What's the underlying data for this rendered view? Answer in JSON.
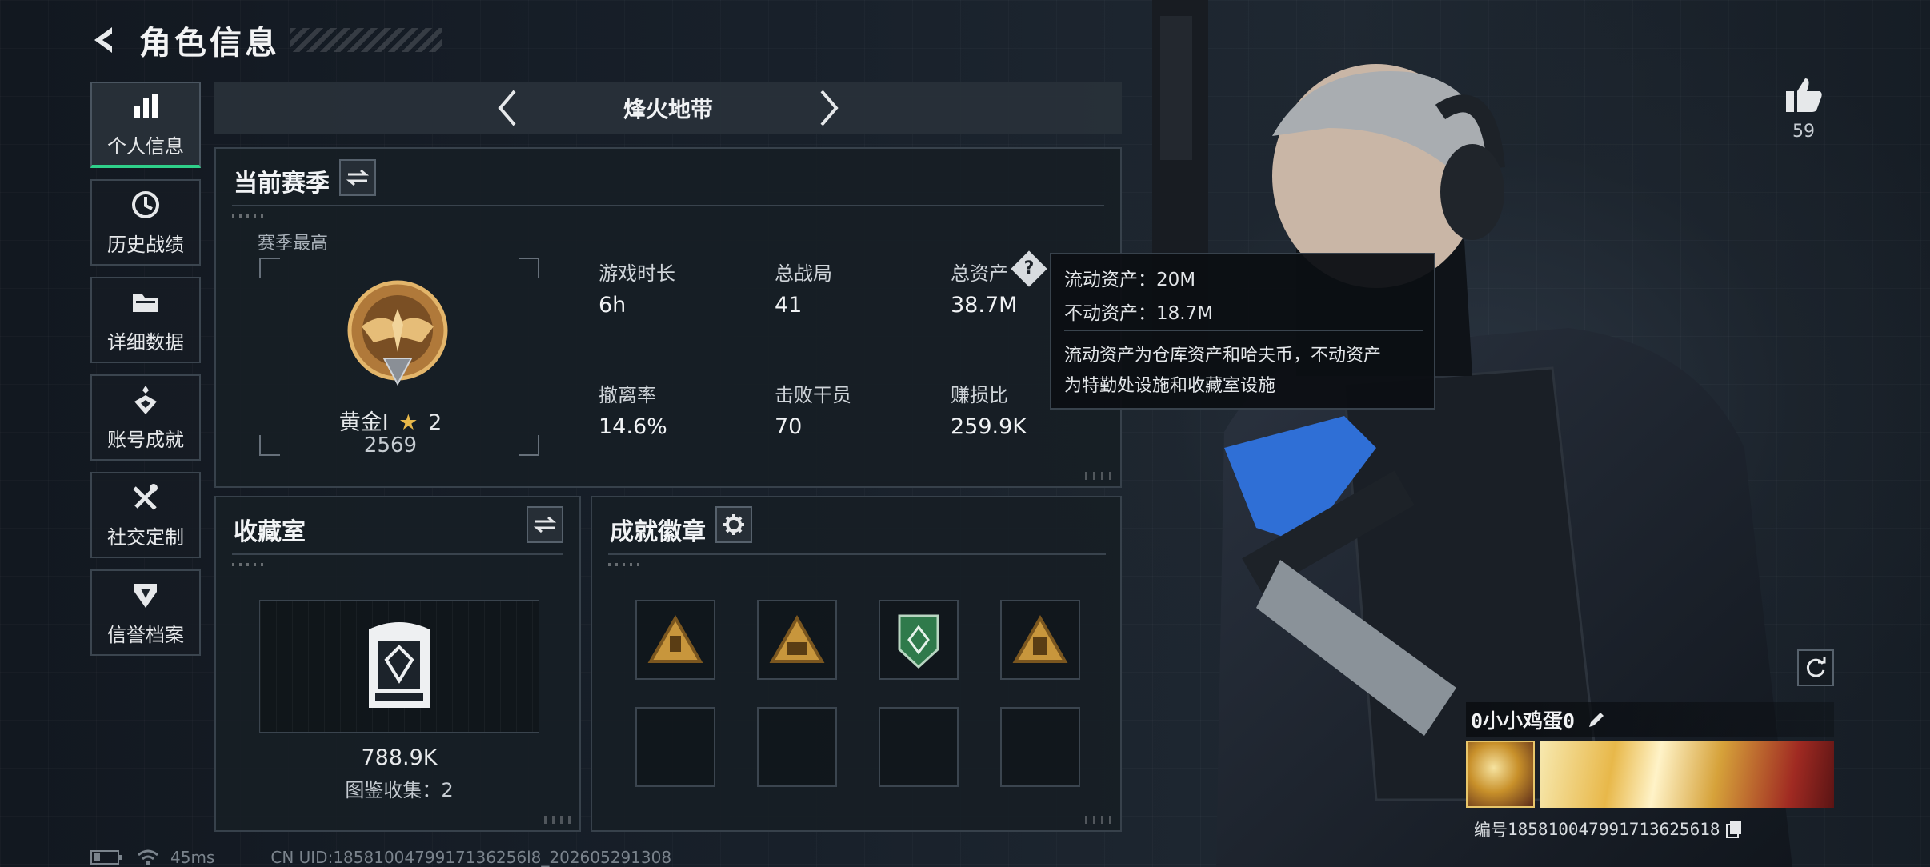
{
  "header": {
    "title": "角色信息"
  },
  "sidebar": {
    "items": [
      {
        "label": "个人信息",
        "icon": "bar-chart-icon"
      },
      {
        "label": "历史战绩",
        "icon": "history-icon"
      },
      {
        "label": "详细数据",
        "icon": "folder-icon"
      },
      {
        "label": "账号成就",
        "icon": "achievement-icon"
      },
      {
        "label": "社交定制",
        "icon": "tools-icon"
      },
      {
        "label": "信誉档案",
        "icon": "shield-icon"
      }
    ],
    "active_index": 0
  },
  "season_selector": {
    "name": "烽火地带"
  },
  "current_season": {
    "title": "当前赛季",
    "best_label": "赛季最高",
    "rank_name": "黄金I",
    "rank_stars": "2",
    "rank_score": "2569",
    "stats": [
      {
        "label": "游戏时长",
        "value": "6h"
      },
      {
        "label": "总战局",
        "value": "41"
      },
      {
        "label": "总资产",
        "value": "38.7M"
      },
      {
        "label": "撤离率",
        "value": "14.6%"
      },
      {
        "label": "击败干员",
        "value": "70"
      },
      {
        "label": "赚损比",
        "value": "259.9K"
      }
    ]
  },
  "tooltip": {
    "line1": "流动资产：20M",
    "line2": "不动资产：18.7M",
    "desc1": "流动资产为仓库资产和哈夫币，不动资产",
    "desc2": "为特勤处设施和收藏室设施"
  },
  "collection": {
    "title": "收藏室",
    "value": "788.9K",
    "catalog_label": "图鉴收集：2"
  },
  "achievements": {
    "title": "成就徽章",
    "badges": [
      "bronze-triangle-badge",
      "bronze-triangle-56-badge",
      "green-hex-badge",
      "bronze-triangle-building-badge"
    ]
  },
  "likes": {
    "count": "59"
  },
  "player": {
    "name": "0小小鸡蛋0",
    "id_label": "编号",
    "id": "18581004799171362561​8"
  },
  "status_bar": {
    "ping": "45ms",
    "uid": "CN UID:1858100479917136256l8_202605291308"
  },
  "colors": {
    "accent_green": "#2fd08a",
    "gold": "#c8963c"
  }
}
